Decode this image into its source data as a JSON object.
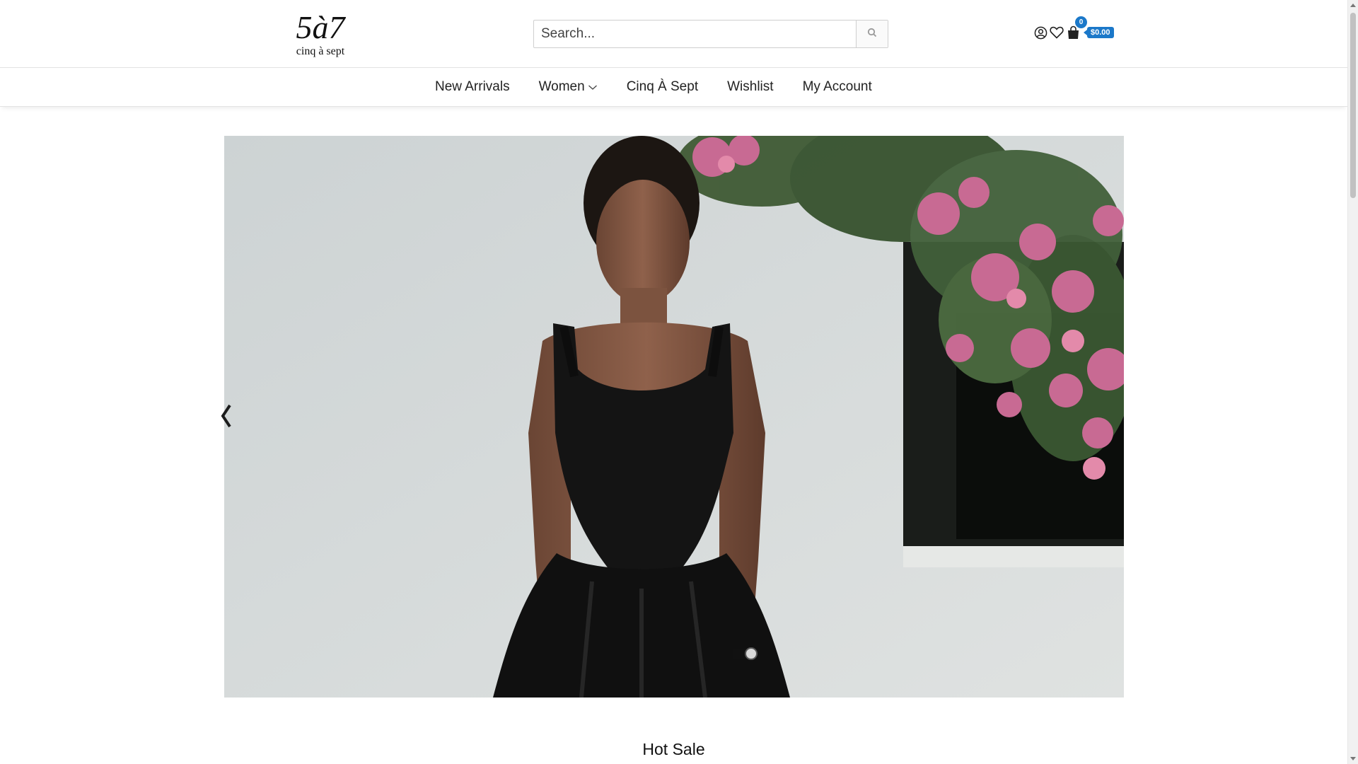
{
  "header": {
    "logo_top": "5à7",
    "logo_bottom": "cinq à sept",
    "search_placeholder": "Search...",
    "cart_count": "0",
    "cart_total": "$0.00"
  },
  "nav": {
    "items": [
      {
        "label": "New Arrivals"
      },
      {
        "label": "Women"
      },
      {
        "label": "Cinq À Sept"
      },
      {
        "label": "Wishlist"
      },
      {
        "label": "My Account"
      }
    ]
  },
  "hero": {
    "image_alt": ""
  },
  "sections": {
    "hot_sale_title": "Hot Sale"
  },
  "colors": {
    "accent": "#1b78c9",
    "border": "#e3e3e3"
  },
  "icons": [
    "user-icon",
    "heart-icon",
    "shopping-bag-icon",
    "search-icon",
    "chevron-down-icon",
    "chevron-left-icon"
  ]
}
